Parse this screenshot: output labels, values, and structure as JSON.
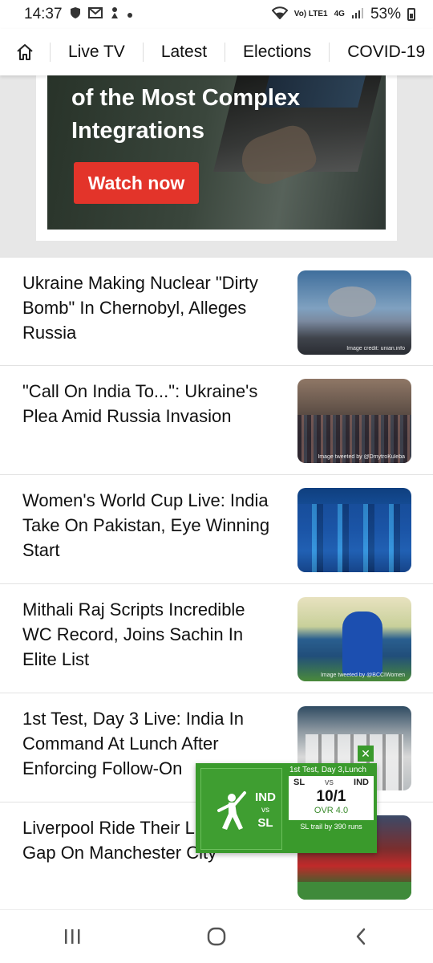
{
  "status_bar": {
    "time": "14:37",
    "network_label": "Vo) LTE1",
    "network_type": "4G",
    "battery": "53%"
  },
  "nav": {
    "home_icon": "home-icon",
    "items": [
      "Live TV",
      "Latest",
      "Elections",
      "COVID-19"
    ]
  },
  "ad": {
    "headline_line1": "of the Most Complex",
    "headline_line2": "Integrations",
    "button_label": "Watch now"
  },
  "news": [
    {
      "title": "Ukraine Making Nuclear \"Dirty Bomb\" In Chernobyl, Alleges Russia",
      "credit": "Image credit: unian.info"
    },
    {
      "title": "\"Call On India To...\": Ukraine's Plea Amid Russia Invasion",
      "credit": "Image tweeted by @DmytroKuleba"
    },
    {
      "title": "Women's World Cup Live: India Take On Pakistan, Eye Winning Start",
      "credit": ""
    },
    {
      "title": "Mithali Raj Scripts Incredible WC Record, Joins Sachin In Elite List",
      "credit": "Image tweeted by @BCCIWomen"
    },
    {
      "title": "1st Test, Day 3 Live: India In Command At Lunch After Enforcing Follow-On",
      "credit": ""
    },
    {
      "title": "Liverpool Ride Their Luck To Cut Gap On Manchester City",
      "credit": ""
    }
  ],
  "score_widget": {
    "team1": "IND",
    "vs": "vs",
    "team2": "SL",
    "match_label": "1st Test, Day 3,Lunch",
    "batting_team": "SL",
    "mini_vs": "vs",
    "bowling_team": "IND",
    "score": "10/1",
    "overs": "OVR 4.0",
    "trail_text": "SL trail by 390 runs",
    "close_icon": "close-icon",
    "accent_color": "#3a9a2c"
  },
  "system_nav": {
    "recents_icon": "recents-icon",
    "home_icon": "home-circle-icon",
    "back_icon": "back-icon"
  }
}
